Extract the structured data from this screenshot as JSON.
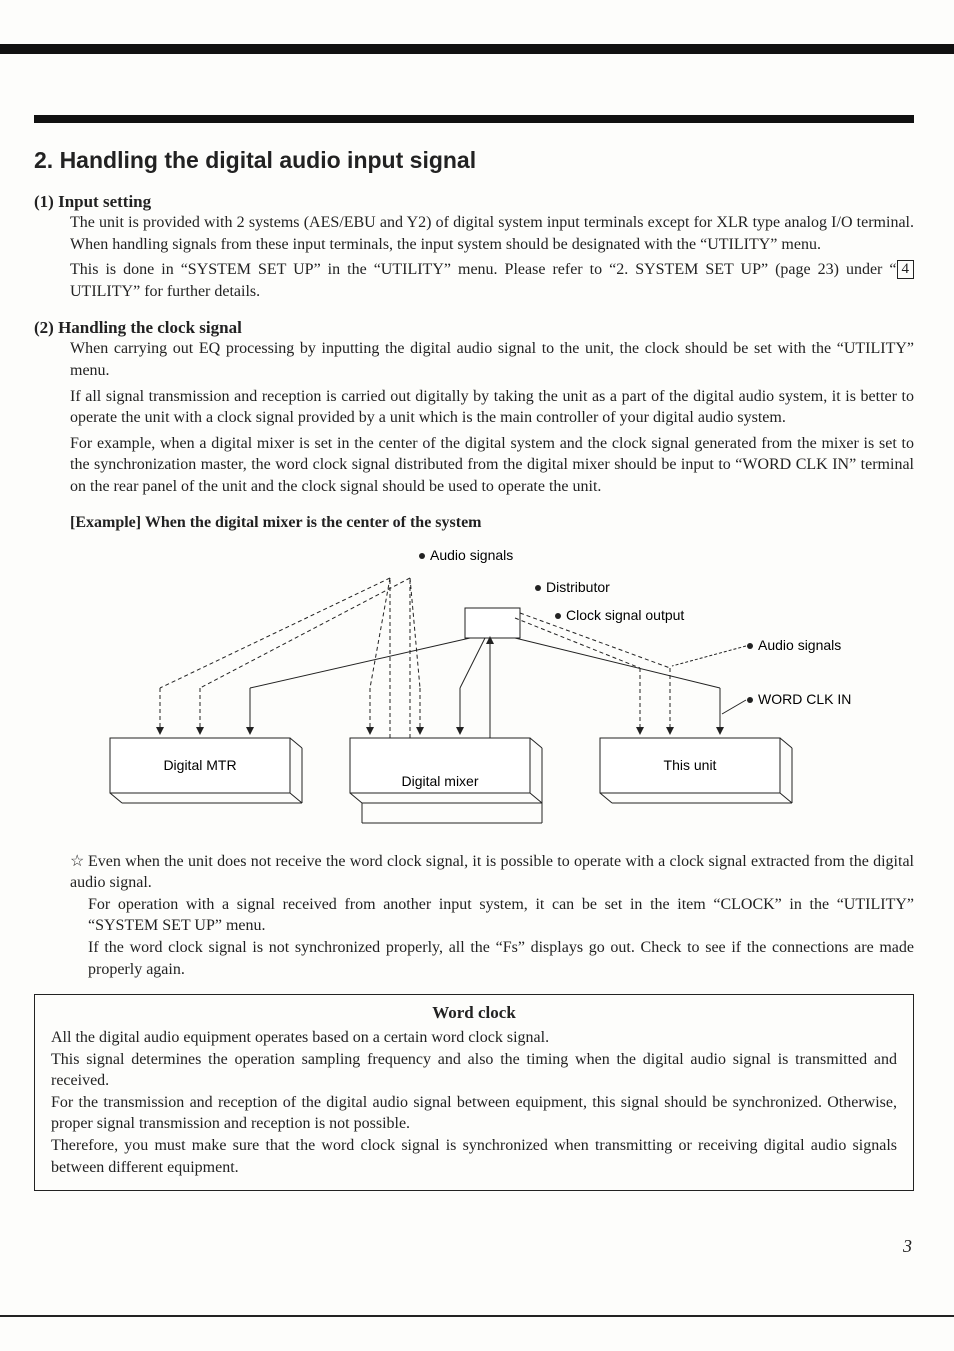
{
  "title": "2.  Handling the digital audio input signal",
  "sec1": {
    "head": "(1) Input setting",
    "p1": "The unit is provided with 2 systems (AES/EBU and Y2) of digital system input terminals except for XLR type analog I/O terminal. When handling signals from these input terminals, the input system should be designated with the “UTILITY” menu.",
    "p2a": "This is done in “SYSTEM SET UP” in the “UTILITY” menu. Please refer to “2. SYSTEM SET UP” (page 23) under “",
    "p2box": "4",
    "p2b": " UTILITY” for further details."
  },
  "sec2": {
    "head": "(2) Handling the clock signal",
    "p1": "When carrying out EQ processing by inputting the digital audio signal to the unit, the clock should be set with the “UTILITY” menu.",
    "p2": "If all signal transmission and reception is carried out digitally by taking the unit as a part of the digital audio system, it is better to operate the unit with a clock signal provided by a unit which is the main controller of your digital audio system.",
    "p3": "For example, when a digital mixer is set in the center of the digital system and the clock signal generated from the mixer is set to the synchronization master, the word clock signal distributed from the digital mixer should be input to “WORD CLK IN” terminal on the rear panel of the unit and the clock signal should be used to operate the unit.",
    "example_head": "[Example]  When the digital mixer is the center of the system"
  },
  "diagram": {
    "audio_signals": "Audio signals",
    "distributor": "Distributor",
    "clock_out": "Clock signal output",
    "audio_signals2": "Audio signals",
    "word_clk_in": "WORD CLK IN",
    "digital_mtr": "Digital MTR",
    "digital_mixer": "Digital mixer",
    "this_unit": "This unit"
  },
  "note": {
    "star": "☆",
    "p1": "Even when the unit does not receive the word clock signal, it is possible to operate with a clock signal extracted from the digital audio signal.",
    "p2": "For operation with a signal received from another input system, it can be set in the item “CLOCK” in the “UTILITY” “SYSTEM SET UP” menu.",
    "p3": "If the word clock signal is not synchronized properly, all the “Fs” displays go out. Check to see if the connections are made properly again."
  },
  "infobox": {
    "title": "Word clock",
    "p1": "All the digital audio equipment operates based on a certain word clock signal.",
    "p2": "This signal determines the operation sampling frequency and also the timing when the digital audio signal is transmitted and received.",
    "p3": "For the transmission and reception of the digital audio signal between equipment, this signal should be synchronized. Otherwise, proper signal transmission and reception is not possible.",
    "p4": "Therefore, you must make sure that the word clock signal is synchronized when transmitting or receiving digital audio signals between different equipment."
  },
  "page_number": "3"
}
